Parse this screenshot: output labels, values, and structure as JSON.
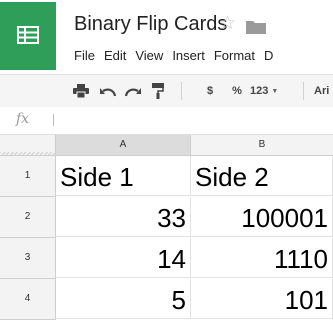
{
  "document": {
    "title": "Binary Flip Cards",
    "star_icon": "star-icon",
    "folder_icon": "folder-icon",
    "app_icon": "sheets-icon",
    "brand_color": "#2f9e58"
  },
  "menu": {
    "items": [
      "File",
      "Edit",
      "View",
      "Insert",
      "Format",
      "D"
    ]
  },
  "toolbar": {
    "icons": [
      "print-icon",
      "undo-icon",
      "redo-icon",
      "paint-format-icon"
    ],
    "currency_label": "$",
    "percent_label": "%",
    "number_format_label": "123",
    "font_label": "Ari"
  },
  "formula_bar": {
    "label": "fx",
    "value": ""
  },
  "sheet": {
    "columns": [
      "A",
      "B"
    ],
    "rows": [
      {
        "num": "1",
        "cells": [
          "Side 1",
          "Side 2"
        ],
        "align": [
          "left",
          "left"
        ]
      },
      {
        "num": "2",
        "cells": [
          "33",
          "100001"
        ],
        "align": [
          "right",
          "right"
        ]
      },
      {
        "num": "3",
        "cells": [
          "14",
          "1110"
        ],
        "align": [
          "right",
          "right"
        ]
      },
      {
        "num": "4",
        "cells": [
          "5",
          "101"
        ],
        "align": [
          "right",
          "right"
        ]
      }
    ]
  }
}
